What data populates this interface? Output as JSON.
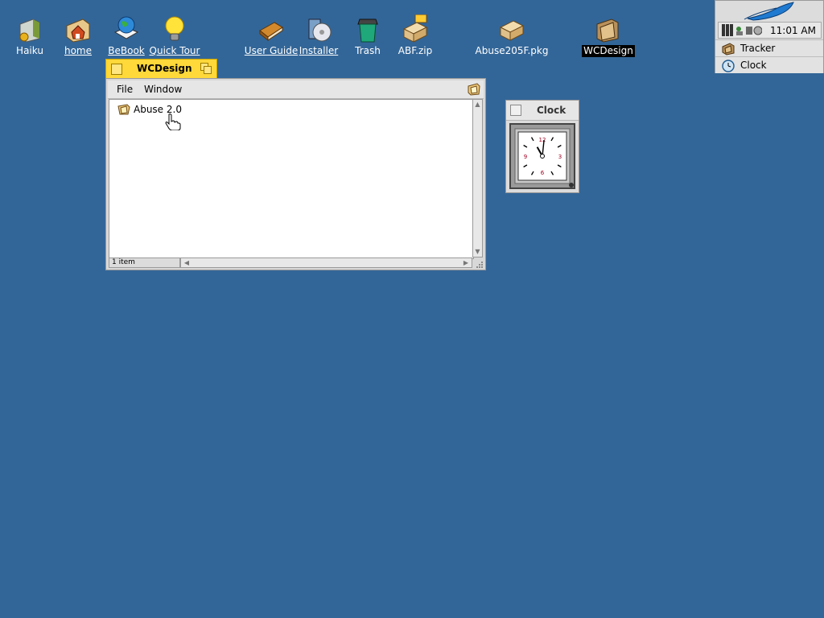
{
  "desktop": {
    "icons": [
      {
        "label": "Haiku",
        "icon": "disk-volume-icon",
        "left": 0
      },
      {
        "label": "home",
        "icon": "home-folder-icon",
        "left": 0
      },
      {
        "label": "BeBook",
        "icon": "globe-book-icon",
        "left": 0
      },
      {
        "label": "Quick Tour",
        "icon": "lightbulb-icon",
        "left": 0
      },
      {
        "label": "User Guide",
        "icon": "book-icon",
        "left": 0
      },
      {
        "label": "Installer",
        "icon": "installer-cd-icon",
        "left": 0
      },
      {
        "label": "Trash",
        "icon": "trash-icon",
        "left": 0
      },
      {
        "label": "ABF.zip",
        "icon": "zip-package-icon",
        "left": 0
      },
      {
        "label": "Abuse205F.pkg",
        "icon": "package-icon",
        "left": 0
      },
      {
        "label": "WCDesign",
        "icon": "folder-icon",
        "left": 0
      }
    ]
  },
  "window": {
    "title": "WCDesign",
    "menus": [
      "File",
      "Window"
    ],
    "items": [
      {
        "name": "Abuse 2.0",
        "icon": "app-folder-icon"
      }
    ],
    "status": "1 item"
  },
  "clock": {
    "title": "Clock",
    "face_numerals": [
      "12",
      "3",
      "6",
      "9"
    ],
    "hour": 11,
    "minute": 1
  },
  "deskbar": {
    "time": "11:01 AM",
    "apps": [
      {
        "label": "Tracker",
        "icon": "tracker-icon"
      },
      {
        "label": "Clock",
        "icon": "clock-app-icon"
      }
    ]
  },
  "colors": {
    "desktop_bg": "#336698",
    "active_tab": "#ffd83a",
    "window_chrome": "#d8d8d8"
  }
}
